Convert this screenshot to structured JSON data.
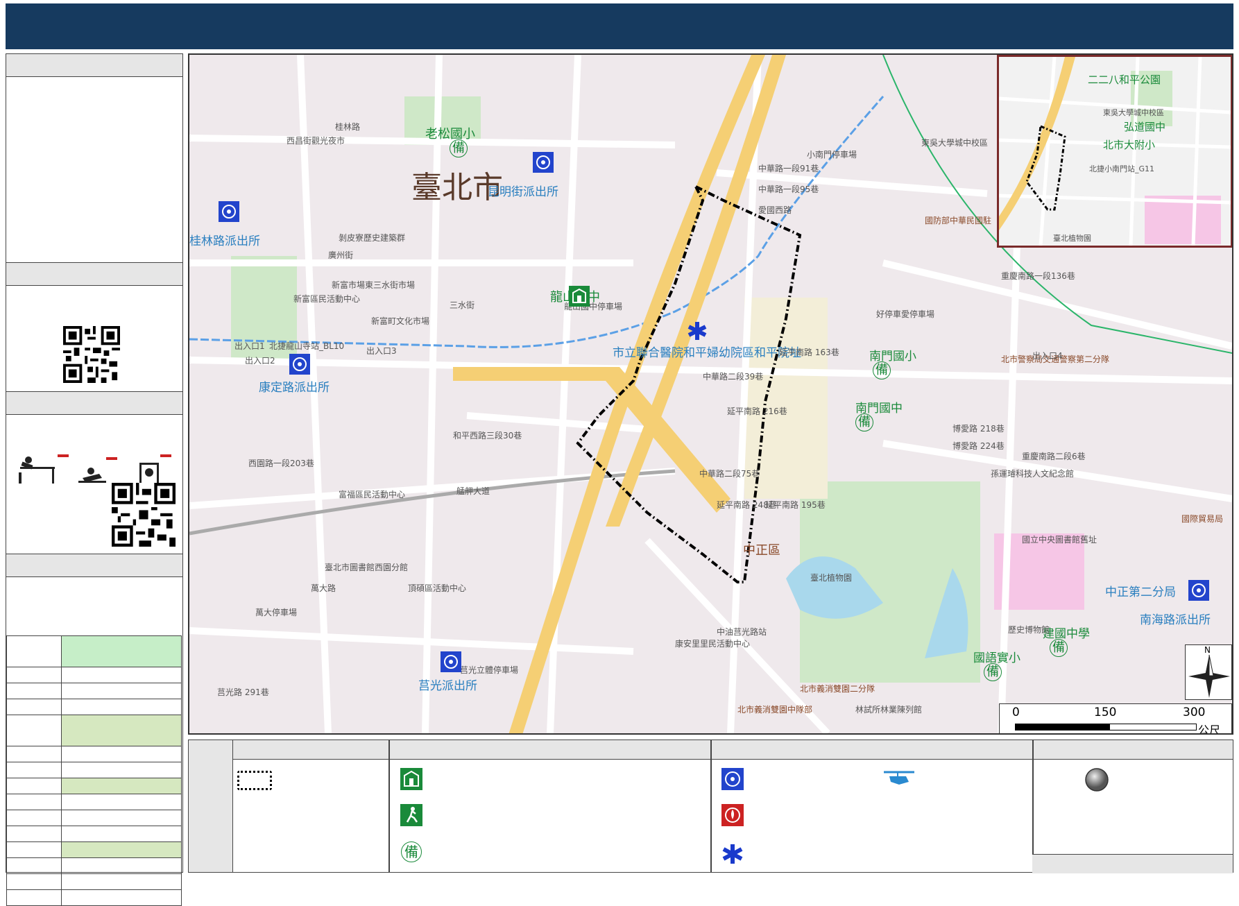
{
  "map": {
    "big_label": "臺北市",
    "district_label": "中正區",
    "places": [
      {
        "t": "老松國小",
        "c": "green",
        "fs": 18
      },
      {
        "t": "龍山國中",
        "c": "green",
        "fs": 18
      },
      {
        "t": "南門國小",
        "c": "green",
        "fs": 17
      },
      {
        "t": "南門國中",
        "c": "green",
        "fs": 17
      },
      {
        "t": "建國中學",
        "c": "green",
        "fs": 17
      },
      {
        "t": "國語實小",
        "c": "green",
        "fs": 17
      },
      {
        "t": "昆明街派出所",
        "c": "blue",
        "fs": 17
      },
      {
        "t": "桂林路派出所",
        "c": "blue",
        "fs": 17
      },
      {
        "t": "康定路派出所",
        "c": "blue",
        "fs": 17
      },
      {
        "t": "莒光派出所",
        "c": "blue",
        "fs": 17
      },
      {
        "t": "中正第二分局",
        "c": "blue",
        "fs": 17
      },
      {
        "t": "南海路派出所",
        "c": "blue",
        "fs": 17
      },
      {
        "t": "市立聯合醫院和平婦幼院區和平院址",
        "c": "blue",
        "fs": 17
      },
      {
        "t": "桂林路",
        "c": "gray",
        "fs": 12
      },
      {
        "t": "廣州街",
        "c": "gray",
        "fs": 12
      },
      {
        "t": "三水街",
        "c": "gray",
        "fs": 12
      },
      {
        "t": "和平西路三段30巷",
        "c": "gray",
        "fs": 12
      },
      {
        "t": "西園路一段203巷",
        "c": "gray",
        "fs": 12
      },
      {
        "t": "艋舺大道",
        "c": "gray",
        "fs": 12
      },
      {
        "t": "萬大路",
        "c": "gray",
        "fs": 12
      },
      {
        "t": "莒光路 291巷",
        "c": "gray",
        "fs": 12
      },
      {
        "t": "中華路一段91巷",
        "c": "gray",
        "fs": 12
      },
      {
        "t": "中華路一段95巷",
        "c": "gray",
        "fs": 12
      },
      {
        "t": "中華路二段39巷",
        "c": "gray",
        "fs": 12
      },
      {
        "t": "中華路二段75巷",
        "c": "gray",
        "fs": 12
      },
      {
        "t": "延平南路 216巷",
        "c": "gray",
        "fs": 12
      },
      {
        "t": "延平南路 248巷",
        "c": "gray",
        "fs": 12
      },
      {
        "t": "延平南路 195巷",
        "c": "gray",
        "fs": 12
      },
      {
        "t": "延平南路 163巷",
        "c": "gray",
        "fs": 12
      },
      {
        "t": "愛國西路",
        "c": "gray",
        "fs": 12
      },
      {
        "t": "重慶南路一段136巷",
        "c": "gray",
        "fs": 12
      },
      {
        "t": "博愛路 218巷",
        "c": "gray",
        "fs": 12
      },
      {
        "t": "博愛路 224巷",
        "c": "gray",
        "fs": 12
      },
      {
        "t": "重慶南路二段6巷",
        "c": "gray",
        "fs": 12
      },
      {
        "t": "北市警察局交通警察第二分隊",
        "c": "brown",
        "fs": 12
      },
      {
        "t": "國防部中華民國駐",
        "c": "brown",
        "fs": 12
      },
      {
        "t": "國立中央圖書館舊址",
        "c": "gray",
        "fs": 12
      },
      {
        "t": "臺北植物園",
        "c": "gray",
        "fs": 12
      },
      {
        "t": "孫運璿科技人文紀念館",
        "c": "gray",
        "fs": 12
      },
      {
        "t": "歷史博物館",
        "c": "gray",
        "fs": 12
      },
      {
        "t": "國際貿易局",
        "c": "brown",
        "fs": 12
      },
      {
        "t": "北市義消雙園二分隊",
        "c": "brown",
        "fs": 12
      },
      {
        "t": "北市義消雙園中隊部",
        "c": "brown",
        "fs": 12
      },
      {
        "t": "林試所林業陳列館",
        "c": "gray",
        "fs": 12
      },
      {
        "t": "中油莒光路站",
        "c": "gray",
        "fs": 12
      },
      {
        "t": "康安里里民活動中心",
        "c": "gray",
        "fs": 12
      },
      {
        "t": "新富市場東三水街市場",
        "c": "gray",
        "fs": 12
      },
      {
        "t": "新富區民活動中心",
        "c": "gray",
        "fs": 12
      },
      {
        "t": "新富町文化市場",
        "c": "gray",
        "fs": 12
      },
      {
        "t": "北捷龍山寺站_BL10",
        "c": "gray",
        "fs": 12
      },
      {
        "t": "出入口1",
        "c": "gray",
        "fs": 12
      },
      {
        "t": "出入口2",
        "c": "gray",
        "fs": 12
      },
      {
        "t": "出入口3",
        "c": "gray",
        "fs": 12
      },
      {
        "t": "出入口4",
        "c": "gray",
        "fs": 12
      },
      {
        "t": "剝皮寮歷史建築群",
        "c": "gray",
        "fs": 12
      },
      {
        "t": "西昌街觀光夜市",
        "c": "gray",
        "fs": 12
      },
      {
        "t": "臺北市圖書館西園分館",
        "c": "gray",
        "fs": 12
      },
      {
        "t": "頂碩區活動中心",
        "c": "gray",
        "fs": 12
      },
      {
        "t": "富福區民活動中心",
        "c": "gray",
        "fs": 12
      },
      {
        "t": "萬大停車場",
        "c": "gray",
        "fs": 12
      },
      {
        "t": "莒光立體停車場",
        "c": "gray",
        "fs": 12
      },
      {
        "t": "龍山國中停車場",
        "c": "gray",
        "fs": 12
      },
      {
        "t": "東吳大學城中校區",
        "c": "gray",
        "fs": 12
      },
      {
        "t": "小南門停車場",
        "c": "gray",
        "fs": 12
      },
      {
        "t": "好停車愛停車場",
        "c": "gray",
        "fs": 12
      },
      {
        "t": "二二八和平公園",
        "c": "green",
        "fs": 15
      },
      {
        "t": "弘道國中",
        "c": "green",
        "fs": 15
      },
      {
        "t": "北市大附小",
        "c": "green",
        "fs": 15
      },
      {
        "t": "北捷小南門站_G11",
        "c": "gray",
        "fs": 11
      },
      {
        "t": "臺北植物園",
        "c": "gray",
        "fs": 11
      },
      {
        "t": "東吳大學城中校區",
        "c": "gray",
        "fs": 11
      }
    ],
    "scale": {
      "t0": "0",
      "t1": "150",
      "t2": "300",
      "unit": "公尺"
    },
    "north": "N"
  },
  "legend": {
    "bei": "備",
    "colors": {
      "school": "#1a8a3a",
      "police": "#2244cc",
      "fire": "#cc2222",
      "medical": "#1a3acc",
      "route": "#000000",
      "banner": "#163a5f"
    }
  }
}
